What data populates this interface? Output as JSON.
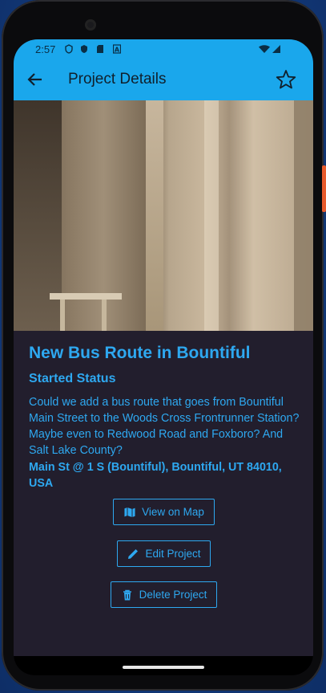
{
  "status_bar": {
    "time": "2:57",
    "icons": [
      "shield-icon",
      "shield-icon",
      "sd-card-icon",
      "font-icon"
    ],
    "right_icons": [
      "wifi-icon",
      "signal-icon"
    ]
  },
  "app_bar": {
    "title": "Project Details",
    "back_icon": "arrow-back-icon",
    "favorite_icon": "star-outline-icon"
  },
  "project": {
    "title": "New Bus Route in Bountiful",
    "status": "Started Status",
    "description": "Could we add a bus route that goes from Bountiful Main Street to the Woods Cross Frontrunner Station? Maybe even to Redwood Road and Foxboro? And Salt Lake County?",
    "address": "Main St @ 1 S (Bountiful), Bountiful, UT 84010, USA"
  },
  "actions": {
    "view_map": "View on Map",
    "edit": "Edit Project",
    "delete": "Delete Project"
  },
  "colors": {
    "accent": "#2ea8f0",
    "app_bar": "#1aa7ec",
    "background": "#221e2d"
  }
}
